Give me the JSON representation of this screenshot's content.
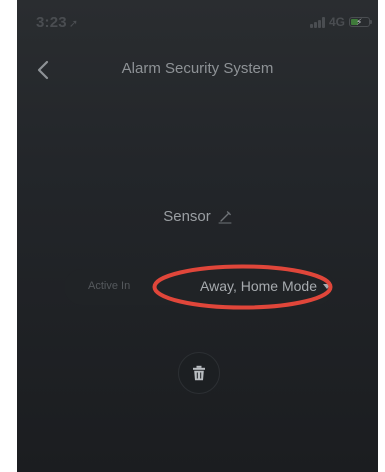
{
  "status_bar": {
    "time": "3:23",
    "location_glyph": "➚",
    "network": "4G",
    "battery_level": 0.4
  },
  "nav": {
    "title": "Alarm Security System",
    "back_icon": "chevron-left-icon"
  },
  "sensor": {
    "name": "Sensor",
    "edit_icon": "pencil-icon"
  },
  "active_in": {
    "label": "Active In",
    "value": "Away, Home Mode",
    "caret_icon": "caret-down-icon"
  },
  "actions": {
    "delete_icon": "trash-icon"
  },
  "colors": {
    "background": "#23262a",
    "highlight": "#e0463a",
    "text_primary": "#a7abaf",
    "text_muted": "#55595d"
  }
}
